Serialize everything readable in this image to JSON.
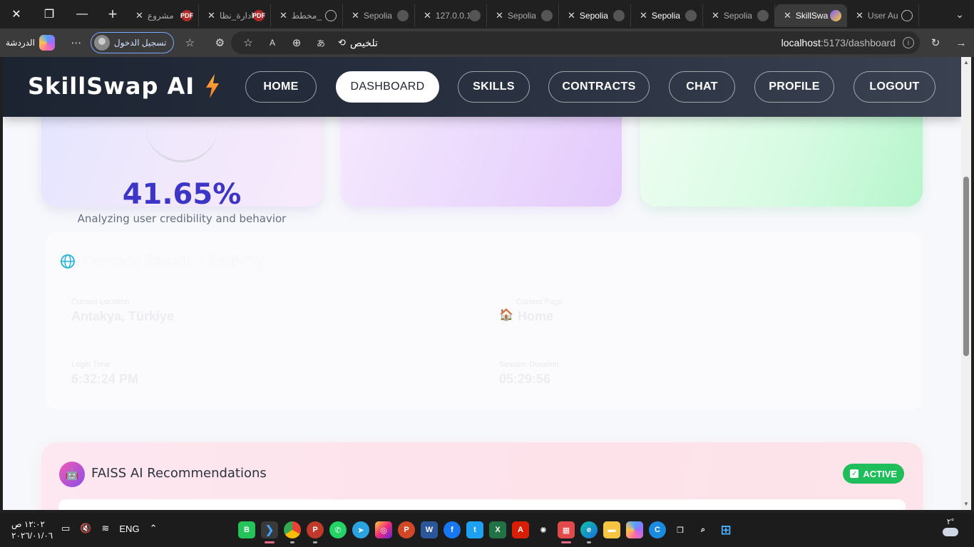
{
  "browser": {
    "tabs": [
      {
        "label": "مشروع",
        "favicon": "pdf",
        "active": false,
        "bright": false
      },
      {
        "label": "ادارة_نظا",
        "favicon": "pdf",
        "active": false,
        "bright": false
      },
      {
        "label": "مخطط_",
        "favicon": "globe",
        "active": false,
        "bright": false
      },
      {
        "label": "Sepolia",
        "favicon": "sep",
        "active": false,
        "bright": false
      },
      {
        "label": "127.0.0.1",
        "favicon": "sep",
        "active": false,
        "bright": false
      },
      {
        "label": "Sepolia",
        "favicon": "sep",
        "active": false,
        "bright": false
      },
      {
        "label": "Sepolia",
        "favicon": "sep",
        "active": false,
        "bright": true
      },
      {
        "label": "Sepolia",
        "favicon": "sep",
        "active": false,
        "bright": true
      },
      {
        "label": "Sepolia",
        "favicon": "sep",
        "active": false,
        "bright": false
      },
      {
        "label": "SkillSwa",
        "favicon": "v",
        "active": true,
        "bright": true
      },
      {
        "label": "User Au",
        "favicon": "globe",
        "active": false,
        "bright": false
      }
    ],
    "toolbar": {
      "copilot_label": "الدردشة",
      "signin_label": "تسجيل الدخول",
      "summarize_label": "تلخيص",
      "url_host": "localhost",
      "url_path": ":5173/dashboard"
    }
  },
  "app": {
    "brand": "SkillSwap AI",
    "nav": [
      {
        "label": "HOME",
        "active": false
      },
      {
        "label": "DASHBOARD",
        "active": true
      },
      {
        "label": "SKILLS",
        "active": false
      },
      {
        "label": "CONTRACTS",
        "active": false
      },
      {
        "label": "CHAT",
        "active": false
      },
      {
        "label": "PROFILE",
        "active": false
      },
      {
        "label": "LOGOUT",
        "active": false
      }
    ],
    "credibility": {
      "score": "41.65%",
      "subtitle": "Analyzing user credibility and behavior"
    },
    "session": {
      "title": "Current Session Activity",
      "location_label": "Current Location",
      "location": "Antakya, Türkiye",
      "page_label": "Current Page",
      "page": "Home",
      "login_label": "Login Time",
      "login_time": "6:32:24 PM",
      "duration_label": "Session Duration",
      "duration": "05:29:56"
    },
    "faiss": {
      "title": "FAISS AI Recommendations",
      "status": "ACTIVE"
    },
    "colors": {
      "score": "#3d35c6",
      "active_badge": "#1fbe5a",
      "navbar": "#1c2432"
    }
  },
  "taskbar": {
    "time": "١٢:٠٢ ص",
    "date": "٢٠٢٦/٠١/٠٦",
    "language": "ENG",
    "weather": "٢°"
  }
}
